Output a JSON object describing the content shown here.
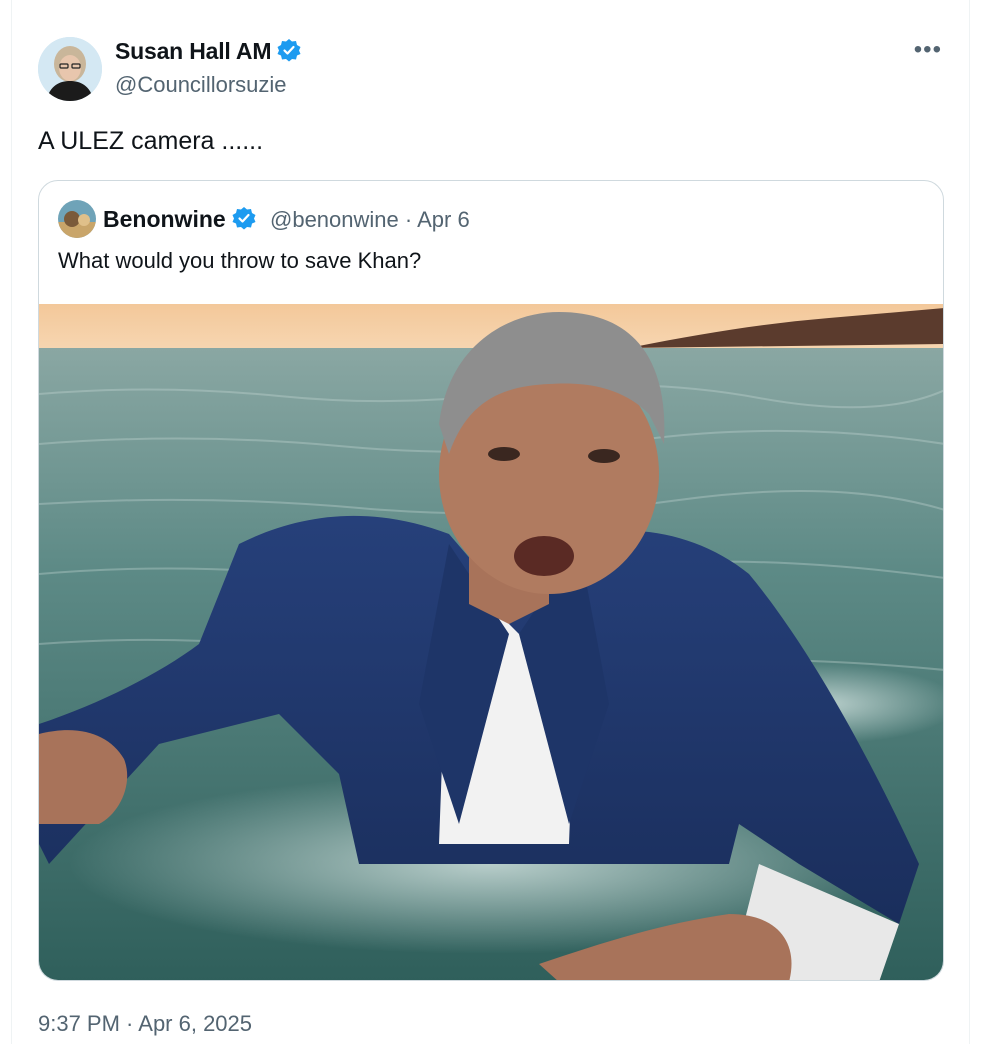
{
  "author": {
    "name": "Susan Hall AM",
    "handle": "@Councillorsuzie"
  },
  "tweet_text": "A ULEZ camera ......",
  "quoted": {
    "name": "Benonwine",
    "handle": "@benonwine",
    "separator": "·",
    "date": "Apr 6",
    "text": "What would you throw to save Khan?"
  },
  "timestamp": "9:37 PM · Apr 6, 2025",
  "icons": {
    "verified": "verified-badge-icon",
    "more": "more-options-icon"
  },
  "colors": {
    "verified": "#1d9bf0",
    "muted_text": "#536471",
    "border": "#cfd9de"
  }
}
